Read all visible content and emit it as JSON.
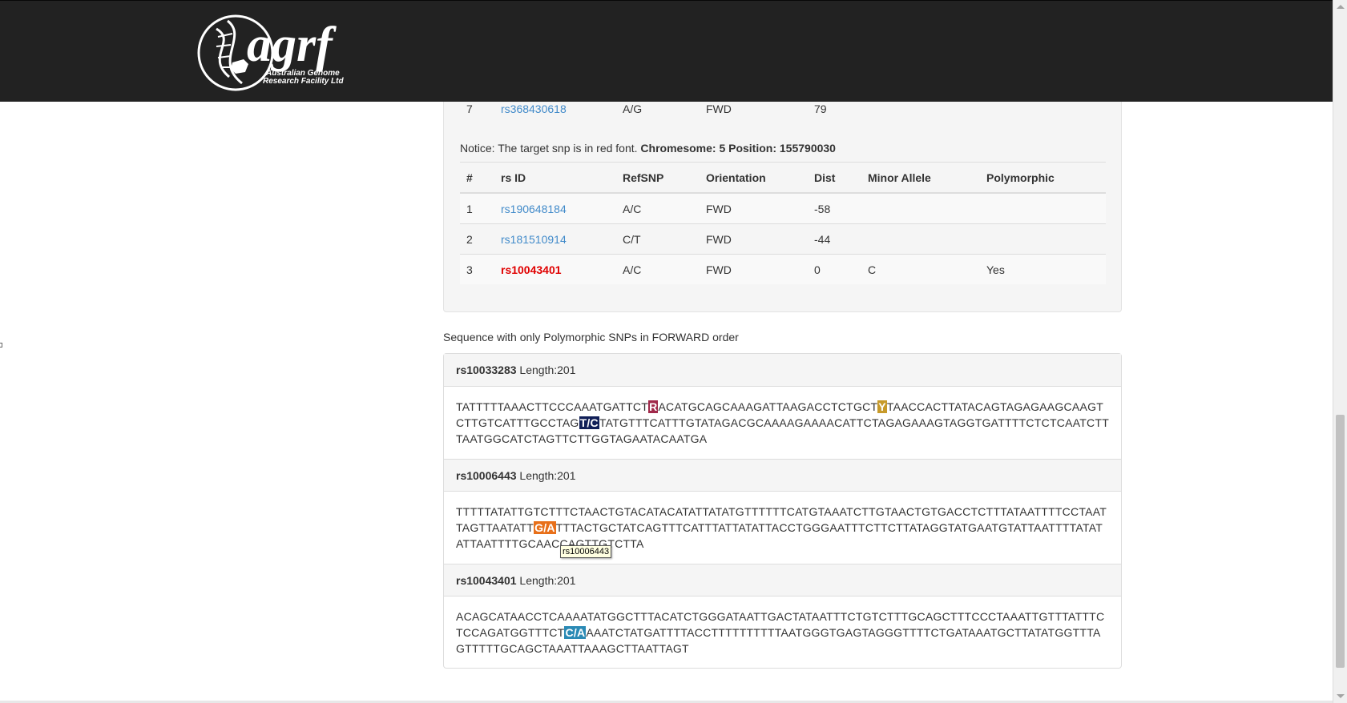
{
  "header": {
    "logo_text": "agrf",
    "logo_subtitle_1": "Australian Genome",
    "logo_subtitle_2": "Research Facility Ltd"
  },
  "prev_table": {
    "row": {
      "num": "7",
      "rs_id": "rs368430618",
      "refsnp": "A/G",
      "orientation": "FWD",
      "dist": "79"
    }
  },
  "notice": {
    "text": "Notice: The target snp is in red font.",
    "chromosome_label": "Chromesome: 5 Position: 155790030"
  },
  "snp_table": {
    "headers": [
      "#",
      "rs ID",
      "RefSNP",
      "Orientation",
      "Dist",
      "Minor Allele",
      "Polymorphic"
    ],
    "rows": [
      {
        "num": "1",
        "rs_id": "rs190648184",
        "refsnp": "A/C",
        "orientation": "FWD",
        "dist": "-58",
        "minor": "",
        "poly": ""
      },
      {
        "num": "2",
        "rs_id": "rs181510914",
        "refsnp": "C/T",
        "orientation": "FWD",
        "dist": "-44",
        "minor": "",
        "poly": ""
      },
      {
        "num": "3",
        "rs_id": "rs10043401",
        "refsnp": "A/C",
        "orientation": "FWD",
        "dist": "0",
        "minor": "C",
        "poly": "Yes"
      }
    ]
  },
  "sequence_section": {
    "title": "Sequence with only Polymorphic SNPs in FORWARD order",
    "sequences": [
      {
        "rs_id": "rs10033283",
        "length": "Length:201",
        "parts": [
          "TATTTTTAAACTTCCCAAATGATTCT",
          "R",
          "ACATGCAGCAAAGATTAAGACCTCTGCT",
          "Y",
          "TAACCACTTATACAGTAGAGAAGCAAGTCTTGTCATTTGCCTAG",
          "T/C",
          "TATGTTTCATTTGTATAGACGCAAAAGAAAACATTCTAGAGAAAGTAGGTGATTTTCTCTCAATCTTTAATGGCATCTAGTTCTTGGTAGAATACAATGA"
        ]
      },
      {
        "rs_id": "rs10006443",
        "length": "Length:201",
        "parts": [
          "TTTTTATATTGTCTTTCTAACTGTACATACATATTATATGTTTTTTCATGTAAATCTTGTAACTGTGACCTCTTTATAATTTTCCTAATTAGTTAATATT",
          "G/A",
          "TTTACTGCTATCAGTTTCATTTATTATATTACCTGGGAATTTCTTCTTATAGGTATGAATGTATTAATTTTATATATTAATTTTGCAACCAGTTGTCTTA"
        ]
      },
      {
        "rs_id": "rs10043401",
        "length": "Length:201",
        "parts": [
          "ACAGCATAACCTCAAAATATGGCTTTACATCTGGGATAATTGACTATAATTTCTGTCTTTGCAGCTTTCCCTAAATTGTTTATTTCTCCAGATGGTTTCT",
          "C/A",
          "AAATCTATGATTTTACCTTTTTTTTTTAATGGGTGAGTAGGGTTTTCTGATAAATGCTTATATGGTTTAGTTTTTGCAGCTAAATTAAAGCTTAATTAGT"
        ]
      }
    ]
  },
  "tooltip": {
    "text": "rs10006443"
  },
  "colors": {
    "header_bg": "#222222",
    "link": "#428bca",
    "target": "#e00000",
    "snp_r": "#a0294a",
    "snp_y": "#c79a2a",
    "snp_tc": "#101f57",
    "snp_ga": "#e8701a",
    "snp_ca": "#2b8ab5"
  }
}
